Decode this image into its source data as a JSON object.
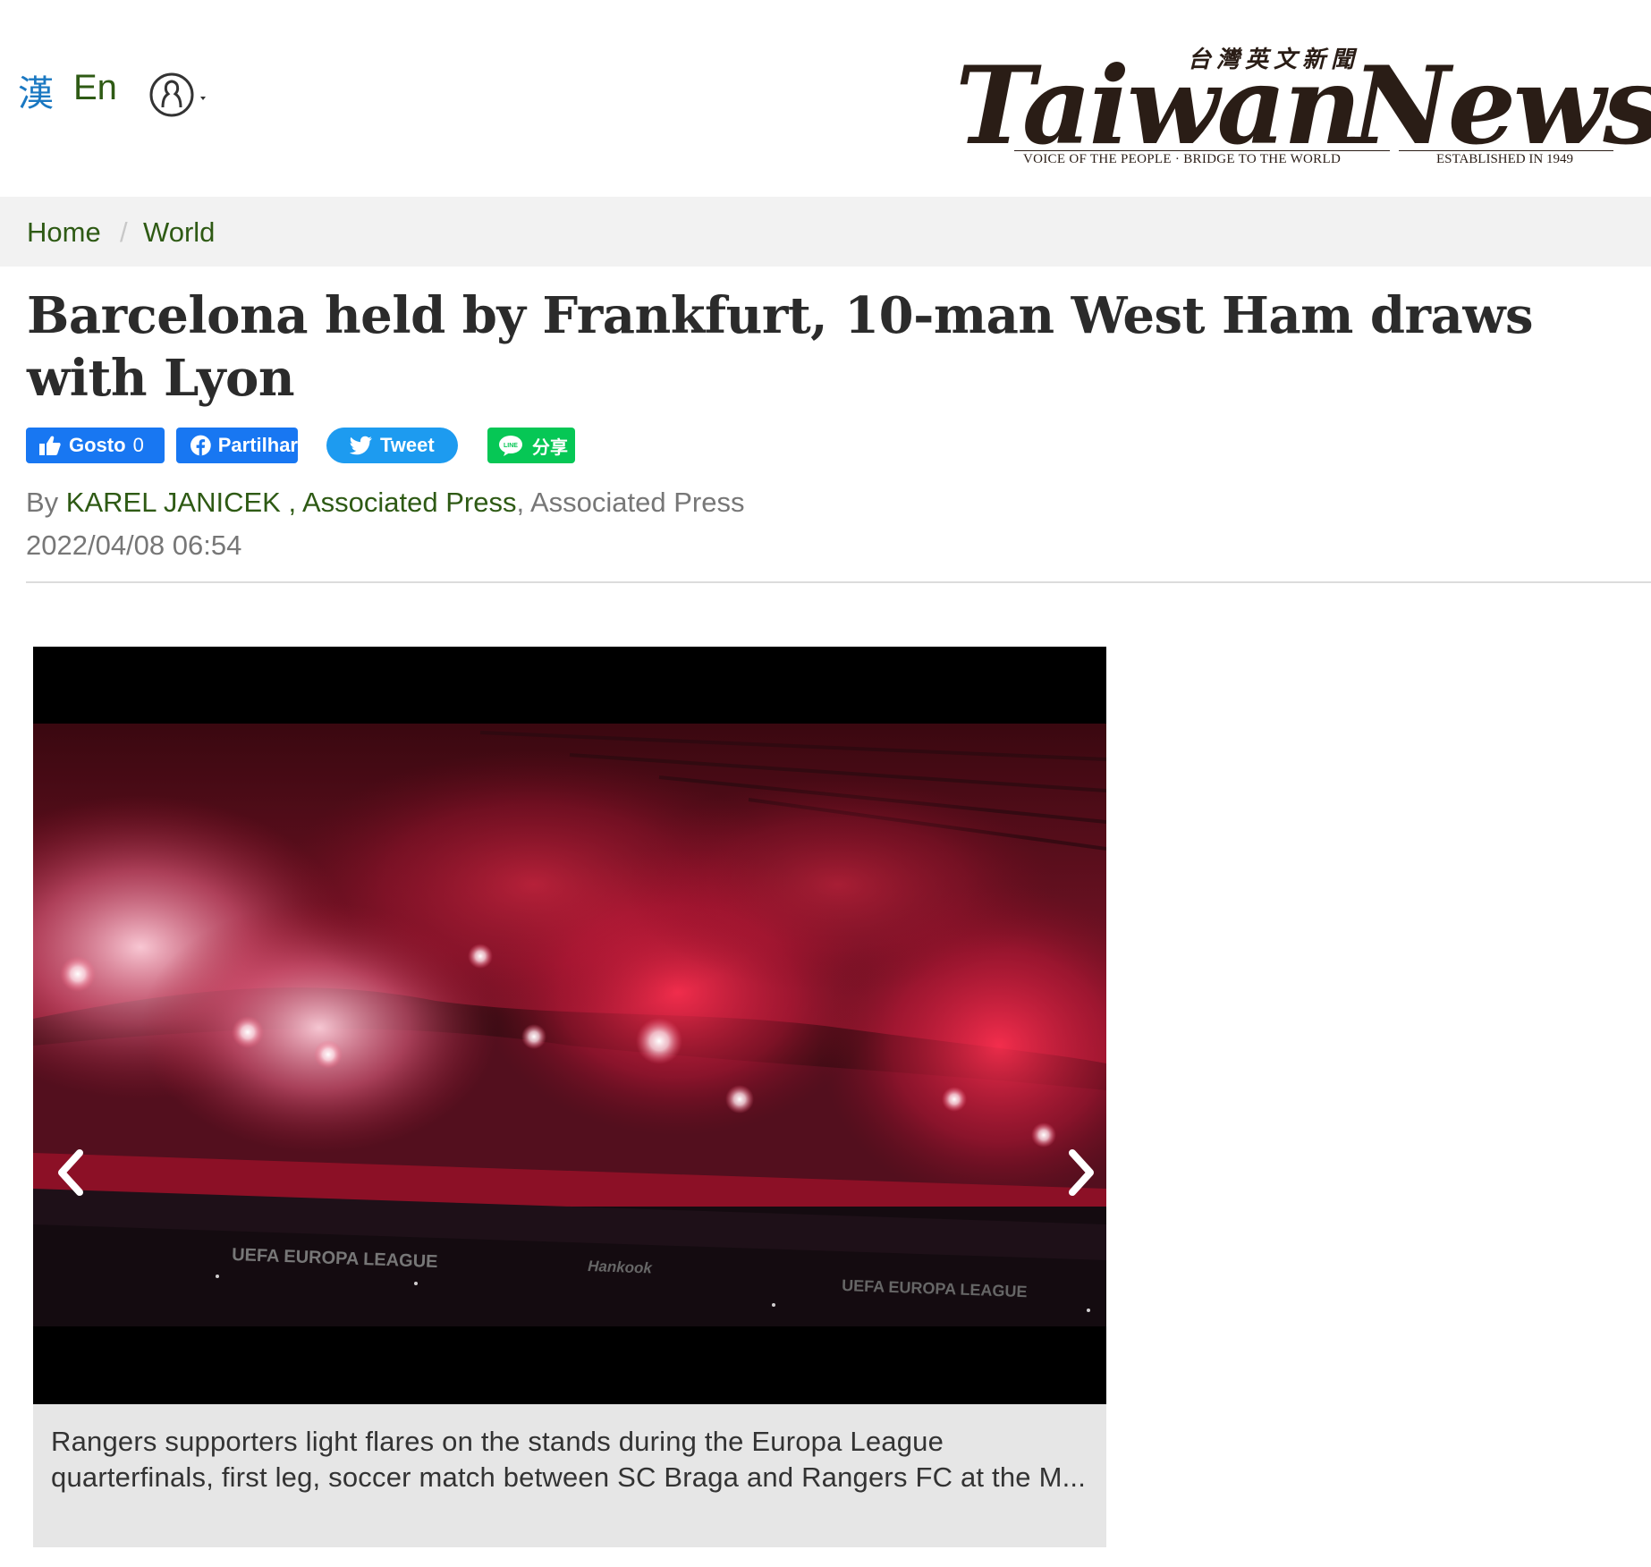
{
  "header": {
    "lang_zh": "漢",
    "lang_en": "En",
    "user_icon": "user-icon"
  },
  "logo": {
    "word1": "Taiwan",
    "word2": "News",
    "chinese": "台灣英文新聞",
    "tagline": "VOICE OF THE PEOPLE · BRIDGE TO THE WORLD",
    "established": "ESTABLISHED IN 1949"
  },
  "breadcrumb": {
    "home": "Home",
    "separator": "/",
    "section": "World"
  },
  "article": {
    "title": "Barcelona held by Frankfurt, 10-man West Ham draws with Lyon",
    "by_prefix": "By ",
    "author": "KAREL JANICEK",
    "author_org": " , Associated Press",
    "source_sep": ", ",
    "source": "Associated Press",
    "date": "2022/04/08 06:54"
  },
  "share": {
    "like_label": "Gosto",
    "like_count": "0",
    "fb_share_label": "Partilhar",
    "tweet_label": "Tweet",
    "line_label": "分享"
  },
  "slideshow": {
    "caption": "Rangers supporters light flares on the stands during the Europa League quarterfinals, first leg, soccer match between SC Braga and Rangers FC at the M...",
    "banner_left": "UEFA EUROPA LEAGUE",
    "banner_mid": "Hankook",
    "banner_right": "UEFA EUROPA LEAGUE"
  },
  "colors": {
    "link_green": "#2e5a14",
    "facebook_blue": "#1877f2",
    "twitter_blue": "#1d9bf0",
    "line_green": "#06c755"
  }
}
